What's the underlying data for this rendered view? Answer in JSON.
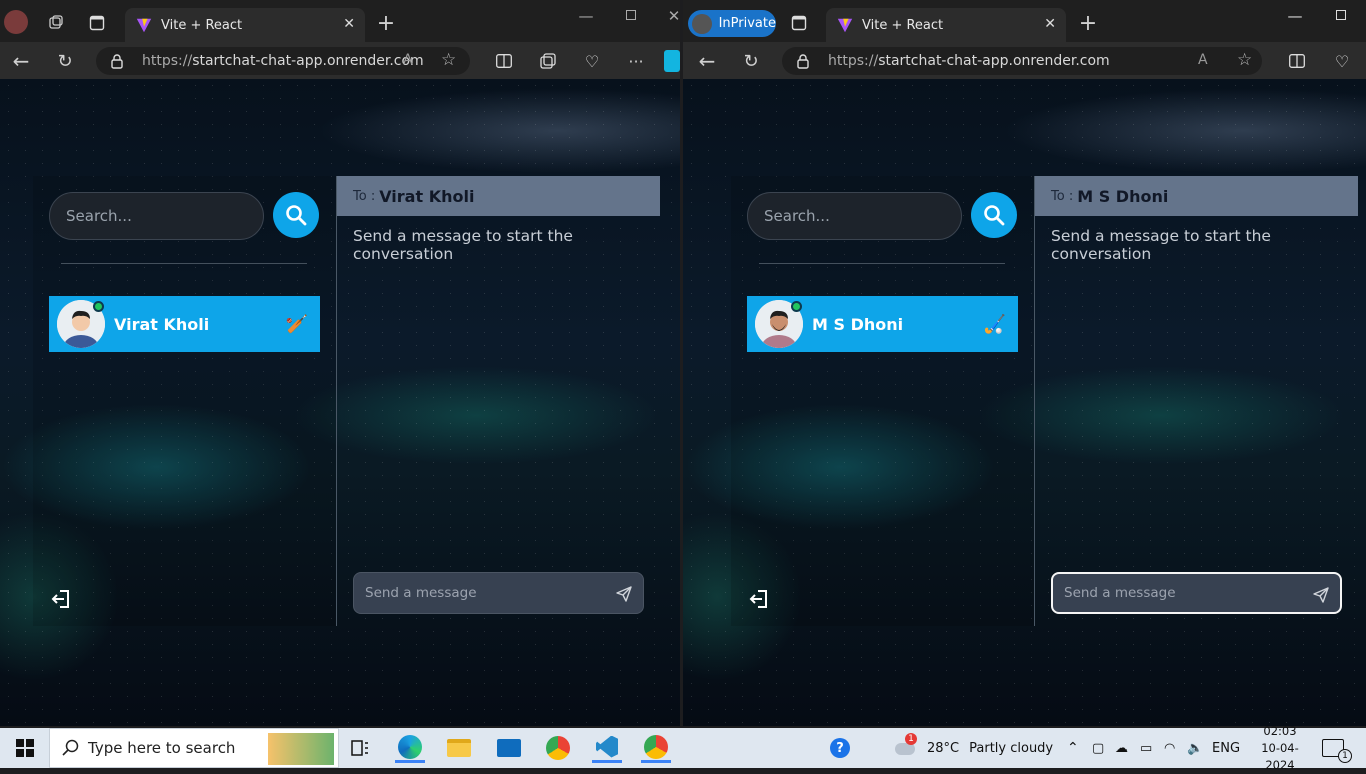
{
  "windows": [
    {
      "private_label": "",
      "tab_title": "Vite + React",
      "url_host": "startchat-chat-app.onrender.com",
      "url_scheme": "https://",
      "search_placeholder": "Search...",
      "contact_name": "Virat Kholi",
      "contact_emoji": "🏏",
      "to_label": "To :",
      "to_name": "Virat Kholi",
      "hint": "Send a message to start the conversation",
      "message_placeholder": "Send a message"
    },
    {
      "private_label": "InPrivate",
      "tab_title": "Vite + React",
      "url_host": "startchat-chat-app.onrender.com",
      "url_scheme": "https://",
      "search_placeholder": "Search...",
      "contact_name": "M S Dhoni",
      "contact_emoji": "🏑",
      "to_label": "To :",
      "to_name": "M S Dhoni",
      "hint": "Send a message to start the conversation",
      "message_placeholder": "Send a message"
    }
  ],
  "taskbar": {
    "search_placeholder": "Type here to search",
    "weather_temp": "28°C",
    "weather_text": "Partly cloudy",
    "weather_badge": "1",
    "language": "ENG",
    "time": "02:03",
    "date": "10-04-2024",
    "notification_count": "1"
  },
  "colors": {
    "accent": "#0ea5e9",
    "chat_header": "#64748b",
    "online": "#22c55e"
  }
}
